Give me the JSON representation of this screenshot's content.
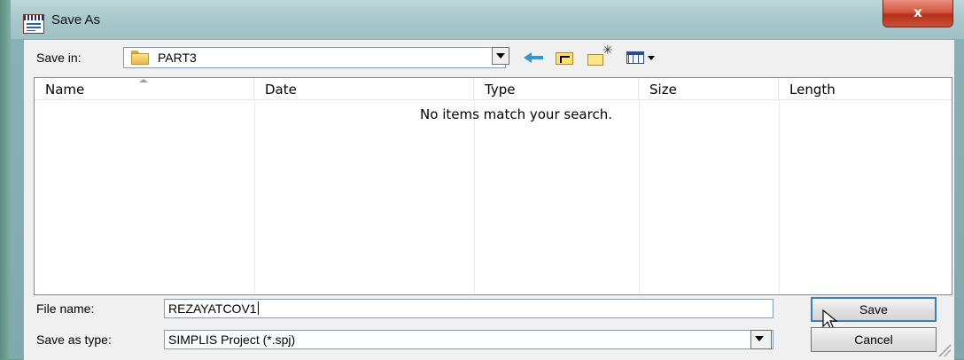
{
  "window": {
    "title": "Save As",
    "close_label": "x"
  },
  "toolbar": {
    "save_in_label": "Save in:",
    "save_in_value": "PART3"
  },
  "list": {
    "columns": [
      "Name",
      "Date",
      "Type",
      "Size",
      "Length"
    ],
    "empty_message": "No items match your search."
  },
  "form": {
    "file_name_label": "File name:",
    "file_name_value": "REZAYATCOV1",
    "save_as_type_label": "Save as type:",
    "save_as_type_value": "SIMPLIS Project (*.spj)"
  },
  "buttons": {
    "save": "Save",
    "cancel": "Cancel"
  },
  "colors": {
    "accent": "#3c7fb1",
    "close": "#c9503a"
  }
}
